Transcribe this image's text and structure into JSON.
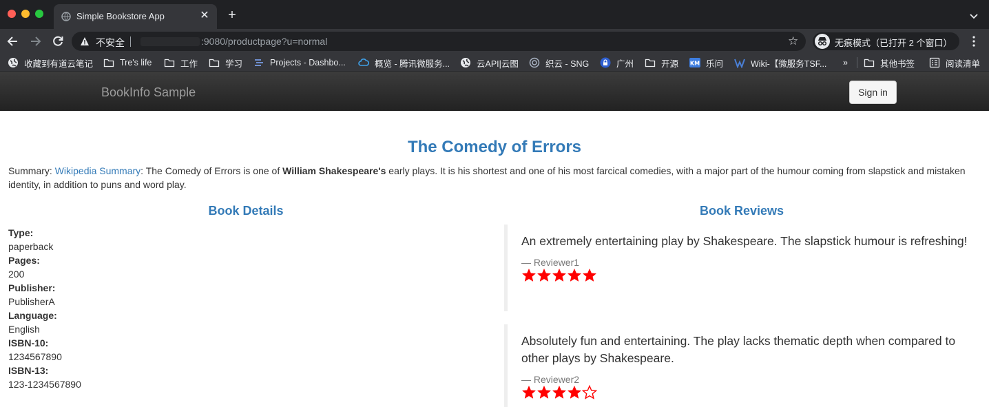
{
  "browser": {
    "tab_title": "Simple Bookstore App",
    "not_secure_label": "不安全",
    "url": ":9080/productpage?u=normal",
    "incognito_label": "无痕模式（已打开 2 个窗口）",
    "bookmarks": [
      {
        "label": "收藏到有道云笔记",
        "icon": "globe-icon"
      },
      {
        "label": "Tre's life",
        "icon": "folder-icon"
      },
      {
        "label": "工作",
        "icon": "folder-icon"
      },
      {
        "label": "学习",
        "icon": "folder-icon"
      },
      {
        "label": "Projects - Dashbo...",
        "icon": "projects-icon"
      },
      {
        "label": "概览 - 腾讯微服务...",
        "icon": "cloud-icon"
      },
      {
        "label": "云API|云图",
        "icon": "globe-icon"
      },
      {
        "label": "织云 - SNG",
        "icon": "zhiyun-icon"
      },
      {
        "label": "广州",
        "icon": "lock-icon"
      },
      {
        "label": "开源",
        "icon": "folder-icon"
      },
      {
        "label": "乐问",
        "icon": "km-icon"
      },
      {
        "label": "Wiki-【微服务TSF...",
        "icon": "wiki-icon"
      }
    ],
    "overflow_label": "»",
    "other_bookmarks": "其他书签",
    "reading_list": "阅读清单"
  },
  "navbar": {
    "brand": "BookInfo Sample",
    "signin_label": "Sign in"
  },
  "product": {
    "title": "The Comedy of Errors",
    "summary_prefix": "Summary: ",
    "summary_link": "Wikipedia Summary",
    "summary_mid": ": The Comedy of Errors is one of ",
    "summary_bold": "William Shakespeare's",
    "summary_rest": " early plays. It is his shortest and one of his most farcical comedies, with a major part of the humour coming from slapstick and mistaken identity, in addition to puns and word play."
  },
  "details": {
    "heading": "Book Details",
    "fields": [
      {
        "label": "Type:",
        "value": "paperback"
      },
      {
        "label": "Pages:",
        "value": "200"
      },
      {
        "label": "Publisher:",
        "value": "PublisherA"
      },
      {
        "label": "Language:",
        "value": "English"
      },
      {
        "label": "ISBN-10:",
        "value": "1234567890"
      },
      {
        "label": "ISBN-13:",
        "value": "123-1234567890"
      }
    ]
  },
  "reviews": {
    "heading": "Book Reviews",
    "star_color": "#ff0000",
    "items": [
      {
        "text": "An extremely entertaining play by Shakespeare. The slapstick humour is refreshing!",
        "reviewer": "— Reviewer1",
        "rating": 5
      },
      {
        "text": "Absolutely fun and entertaining. The play lacks thematic depth when compared to other plays by Shakespeare.",
        "reviewer": "— Reviewer2",
        "rating": 4
      }
    ]
  }
}
